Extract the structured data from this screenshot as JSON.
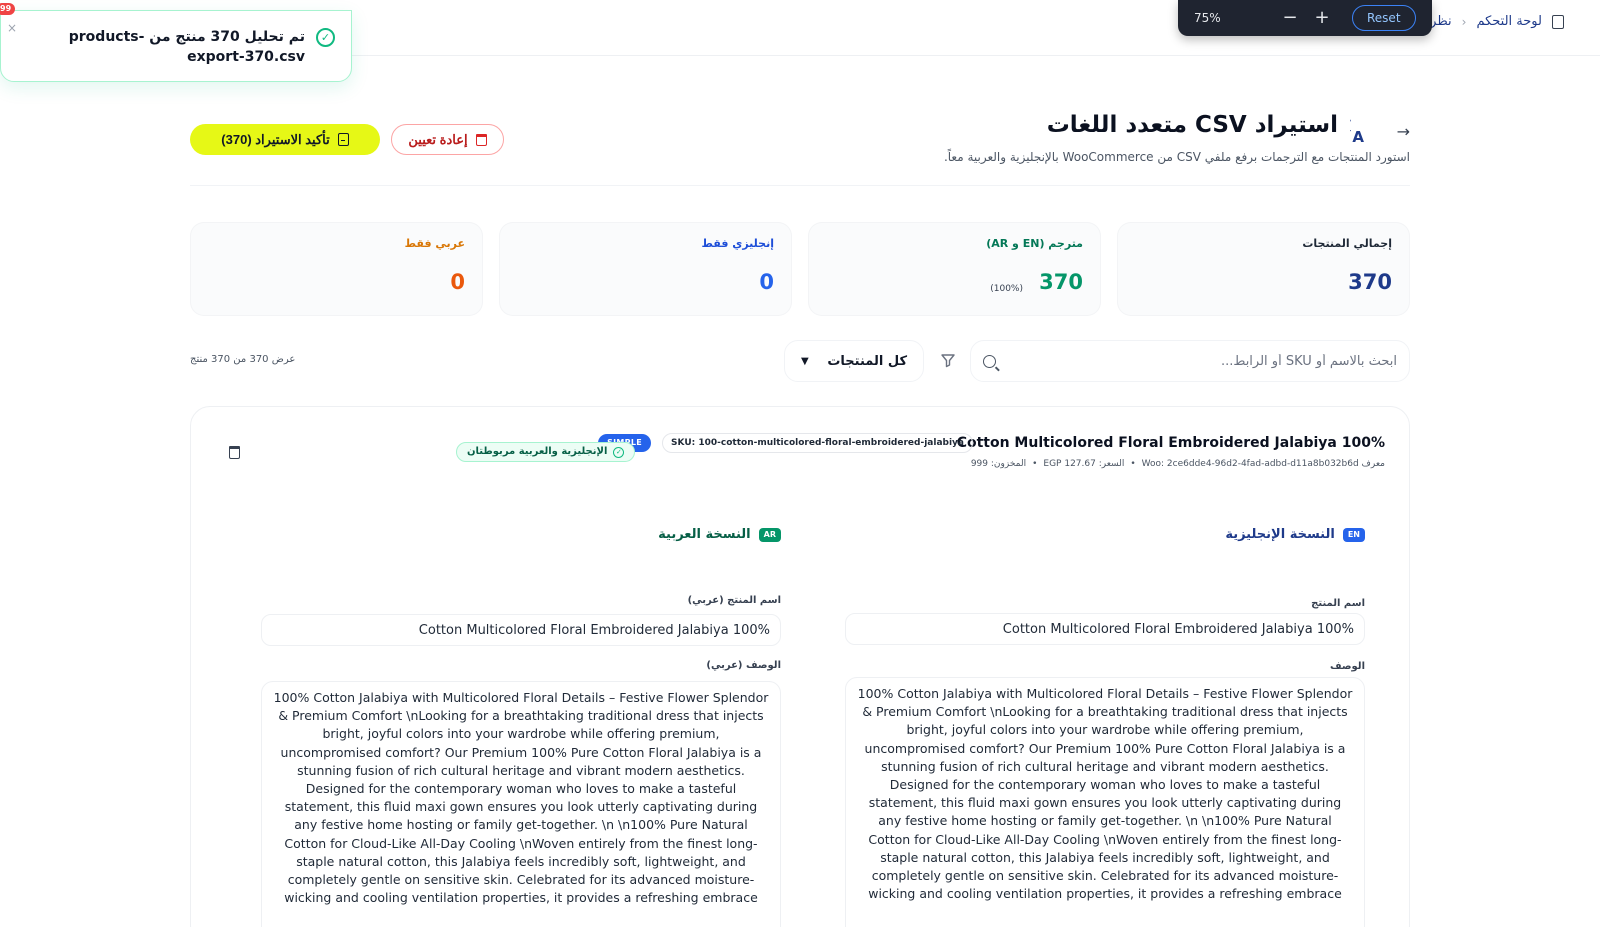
{
  "breadcrumb": {
    "home": "لوحة التحكم",
    "current": "نظرة عا"
  },
  "zoom": {
    "level": "75%",
    "minus": "−",
    "plus": "+",
    "reset": "Reset"
  },
  "toast": {
    "message": "تم تحليل 370 منتج من products-export-370.csv",
    "close": "×",
    "badge": "99"
  },
  "header": {
    "back": "→",
    "title": "استيراد CSV متعدد اللغات",
    "subtitle": "استورد المنتجات مع الترجمات برفع ملفي CSV من WooCommerce بالإنجليزية والعربية معاً.",
    "confirm_label": "تأكيد الاستيراد (370)",
    "reset_label": "إعادة تعيين"
  },
  "stats": [
    {
      "label": "إجمالي المنتجات",
      "value": "370",
      "pct": "",
      "label_color": "#1f2937",
      "value_color": "#1e3a8a"
    },
    {
      "label": "مترجم (EN و AR)",
      "value": "370",
      "pct": "(100%)",
      "label_color": "#047857",
      "value_color": "#059669"
    },
    {
      "label": "إنجليزي فقط",
      "value": "0",
      "pct": "",
      "label_color": "#1d4ed8",
      "value_color": "#2563eb"
    },
    {
      "label": "عربي فقط",
      "value": "0",
      "pct": "",
      "label_color": "#d97706",
      "value_color": "#ea580c"
    }
  ],
  "filters": {
    "search_placeholder": "ابحث بالاسم أو SKU أو الرابط...",
    "select_value": "كل المنتجات",
    "showing": "عرض 370 من 370 منتج"
  },
  "product": {
    "title": "100% Cotton Multicolored Floral Embroidered Jalabiya",
    "sku": "SKU: 100-cotton-multicolored-floral-embroidered-jalabiya",
    "type": "SIMPLE",
    "meta": {
      "woo": "معرف Woo: 2ce6dde4-96d2-4fad-adbd-d11a8b032b6d",
      "price": "السعر: 127.67 EGP",
      "stock": "المخزون: 999",
      "dot": "•"
    },
    "linked": "الإنجليزية والعربية مربوطتان",
    "en": {
      "tag": "EN",
      "heading": "النسخة الإنجليزية",
      "name_label": "اسم المنتج",
      "name_value": "100% Cotton Multicolored Floral Embroidered Jalabiya",
      "desc_label": "الوصف",
      "desc_value": "100% Cotton Jalabiya with Multicolored Floral Details – Festive Flower Splendor & Premium Comfort \\nLooking for a breathtaking traditional dress that injects bright, joyful colors into your wardrobe while offering premium, uncompromised comfort? Our Premium 100% Pure Cotton Floral Jalabiya is a stunning fusion of rich cultural heritage and vibrant modern aesthetics. Designed for the contemporary woman who loves to make a tasteful statement, this fluid maxi gown ensures you look utterly captivating during any festive home hosting or family get-together. \\n \\n100% Pure Natural Cotton for Cloud-Like All-Day Cooling \\nWoven entirely from the finest long-staple natural cotton, this Jalabiya feels incredibly soft, lightweight, and completely gentle on sensitive skin. Celebrated for its advanced moisture-wicking and cooling ventilation properties, it provides a refreshing embrace"
    },
    "ar": {
      "tag": "AR",
      "heading": "النسخة العربية",
      "name_label": "اسم المنتج (عربي)",
      "name_value": "100% Cotton Multicolored Floral Embroidered Jalabiya",
      "desc_label": "الوصف (عربي)",
      "desc_value": "100% Cotton Jalabiya with Multicolored Floral Details – Festive Flower Splendor & Premium Comfort \\nLooking for a breathtaking traditional dress that injects bright, joyful colors into your wardrobe while offering premium, uncompromised comfort? Our Premium 100% Pure Cotton Floral Jalabiya is a stunning fusion of rich cultural heritage and vibrant modern aesthetics. Designed for the contemporary woman who loves to make a tasteful statement, this fluid maxi gown ensures you look utterly captivating during any festive home hosting or family get-together. \\n \\n100% Pure Natural Cotton for Cloud-Like All-Day Cooling \\nWoven entirely from the finest long-staple natural cotton, this Jalabiya feels incredibly soft, lightweight, and completely gentle on sensitive skin. Celebrated for its advanced moisture-wicking and cooling ventilation properties, it provides a refreshing embrace"
    }
  },
  "colors": {
    "accent": "#e6f816",
    "navy": "#1e3a8a",
    "success": "#10b981",
    "danger": "#dc2626"
  }
}
